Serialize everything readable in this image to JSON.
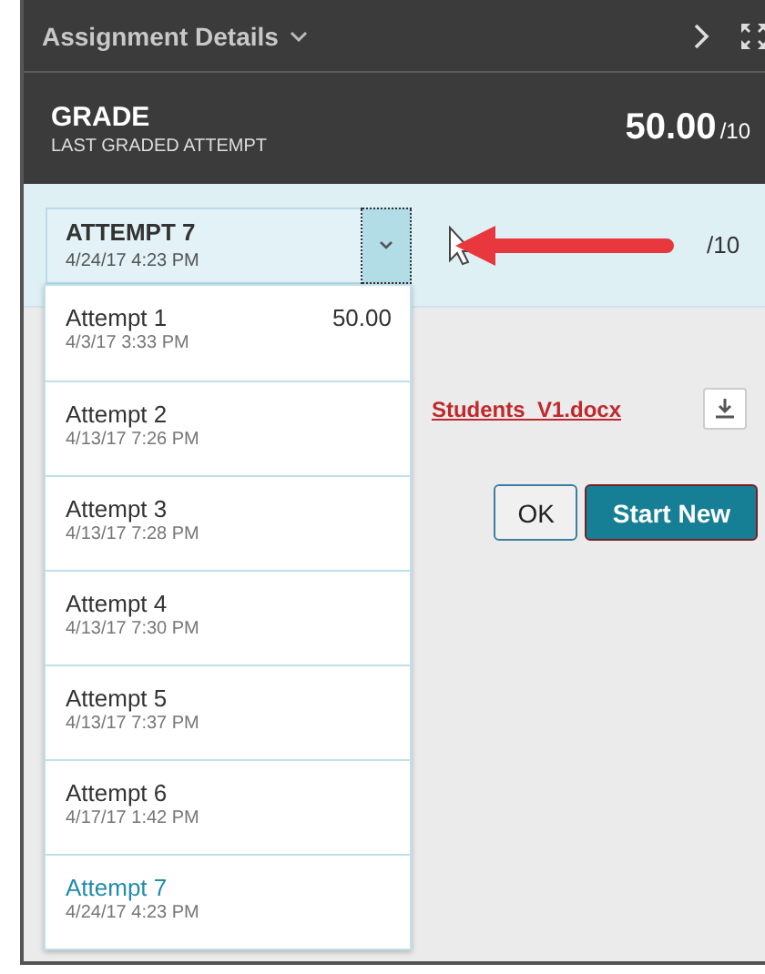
{
  "panel": {
    "title": "Assignment Details"
  },
  "grade": {
    "label": "GRADE",
    "sublabel": "LAST GRADED ATTEMPT",
    "score": "50.00",
    "out_of": "/10"
  },
  "attempt_select": {
    "label": "ATTEMPT 7",
    "date": "4/24/17 4:23 PM",
    "expanded": true,
    "out_of": "/10"
  },
  "attempts": [
    {
      "label": "Attempt 1",
      "date": "4/3/17 3:33 PM",
      "score": "50.00",
      "selected": false
    },
    {
      "label": "Attempt 2",
      "date": "4/13/17 7:26 PM",
      "selected": false
    },
    {
      "label": "Attempt 3",
      "date": "4/13/17 7:28 PM",
      "selected": false
    },
    {
      "label": "Attempt 4",
      "date": "4/13/17 7:30 PM",
      "selected": false
    },
    {
      "label": "Attempt 5",
      "date": "4/13/17 7:37 PM",
      "selected": false
    },
    {
      "label": "Attempt 6",
      "date": "4/17/17 1:42 PM",
      "selected": false
    },
    {
      "label": "Attempt 7",
      "date": "4/24/17 4:23 PM",
      "selected": true
    }
  ],
  "file_link": "Students_V1.docx",
  "buttons": [
    {
      "label": "OK",
      "kind": "secondary"
    },
    {
      "label": "Start New",
      "kind": "primary"
    }
  ]
}
